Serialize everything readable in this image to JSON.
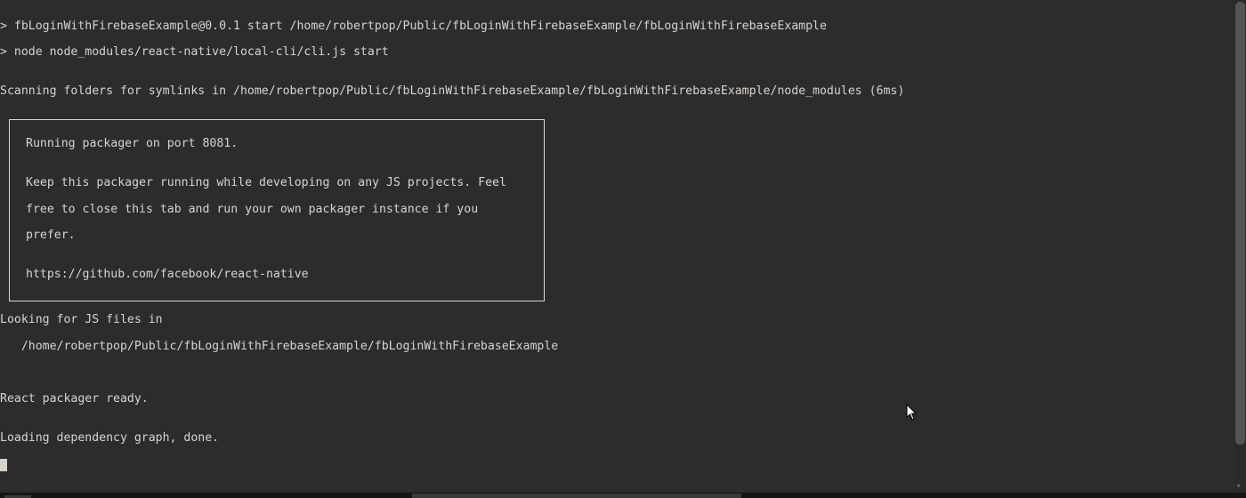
{
  "lines": {
    "l1": "> fbLoginWithFirebaseExample@0.0.1 start /home/robertpop/Public/fbLoginWithFirebaseExample/fbLoginWithFirebaseExample",
    "l2": "> node node_modules/react-native/local-cli/cli.js start",
    "l3": "",
    "l4": "Scanning folders for symlinks in /home/robertpop/Public/fbLoginWithFirebaseExample/fbLoginWithFirebaseExample/node_modules (6ms)"
  },
  "box": {
    "b1": "Running packager on port 8081.",
    "b2": "",
    "b3": "Keep this packager running while developing on any JS projects. Feel",
    "b4": "free to close this tab and run your own packager instance if you",
    "b5": "prefer.",
    "b6": "",
    "b7": "https://github.com/facebook/react-native"
  },
  "after": {
    "a1": "Looking for JS files in",
    "a2": "   /home/robertpop/Public/fbLoginWithFirebaseExample/fbLoginWithFirebaseExample ",
    "a3": "",
    "a4": "",
    "a5": "React packager ready.",
    "a6": "",
    "a7": "Loading dependency graph, done."
  }
}
